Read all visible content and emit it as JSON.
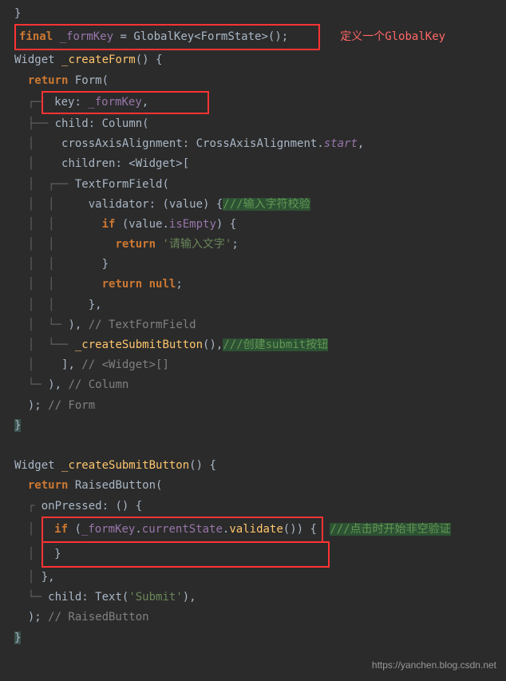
{
  "code": {
    "line1": "}",
    "line2_final": "final",
    "line2_formKey": " _formKey ",
    "line2_equals": "= ",
    "line2_globalKey": "GlobalKey",
    "line2_formState": "<FormState>",
    "line2_call": "();",
    "line2_annotation": "定义一个GlobalKey",
    "line3_widget": "Widget ",
    "line3_createForm": "_createForm",
    "line3_params": "() {",
    "line4_return": "return",
    "line4_form": " Form",
    "line4_open": "(",
    "line5_key": "key",
    "line5_colon": ": ",
    "line5_formKey": "_formKey",
    "line5_comma": ",",
    "line6_child": "child",
    "line6_column": ": Column(",
    "line7_cross": "crossAxisAlignment: CrossAxisAlignment.",
    "line7_start": "start",
    "line7_comma": ",",
    "line8_children": "children: <Widget>[",
    "line9_textFormField": "TextFormField",
    "line9_open": "(",
    "line10_validator": "validator: (value) {",
    "line10_comment": "///输入字符校验",
    "line11_if": "if",
    "line11_cond": " (value.",
    "line11_isEmpty": "isEmpty",
    "line11_close": ") {",
    "line12_return": "return",
    "line12_string": "'请输入文字'",
    "line12_semi": ";",
    "line13_close": "}",
    "line14_returnNull": "return null",
    "line14_semi": ";",
    "line15_close": "},",
    "line16_close": "),",
    "line16_comment": " // TextFormField",
    "line17_createSubmit": "_createSubmitButton",
    "line17_call": "(),",
    "line17_comment": "///创建submit按钮",
    "line18_close": "],",
    "line18_comment": " // <Widget>[]",
    "line19_close": "),",
    "line19_comment": " // Column",
    "line20_close": ");",
    "line20_comment": " // Form",
    "line21_close": "}",
    "line23_widget": "Widget ",
    "line23_createSubmitButton": "_createSubmitButton",
    "line23_params": "() {",
    "line24_return": "return",
    "line24_raised": " RaisedButton",
    "line24_open": "(",
    "line25_onPressed": "onPressed: () {",
    "line26_if": "if",
    "line26_open": " (",
    "line26_formKey": "_formKey",
    "line26_dot1": ".",
    "line26_currentState": "currentState",
    "line26_dot2": ".",
    "line26_validate": "validate",
    "line26_call": "()) {",
    "line26_comment": "///点击时开始非空验证",
    "line27_close": "}",
    "line28_close": "},",
    "line29_child": "child: Text(",
    "line29_string": "'Submit'",
    "line29_close": "),",
    "line30_close": ");",
    "line30_comment": " // RaisedButton",
    "line31_close": "}"
  },
  "watermark": "https://yanchen.blog.csdn.net"
}
